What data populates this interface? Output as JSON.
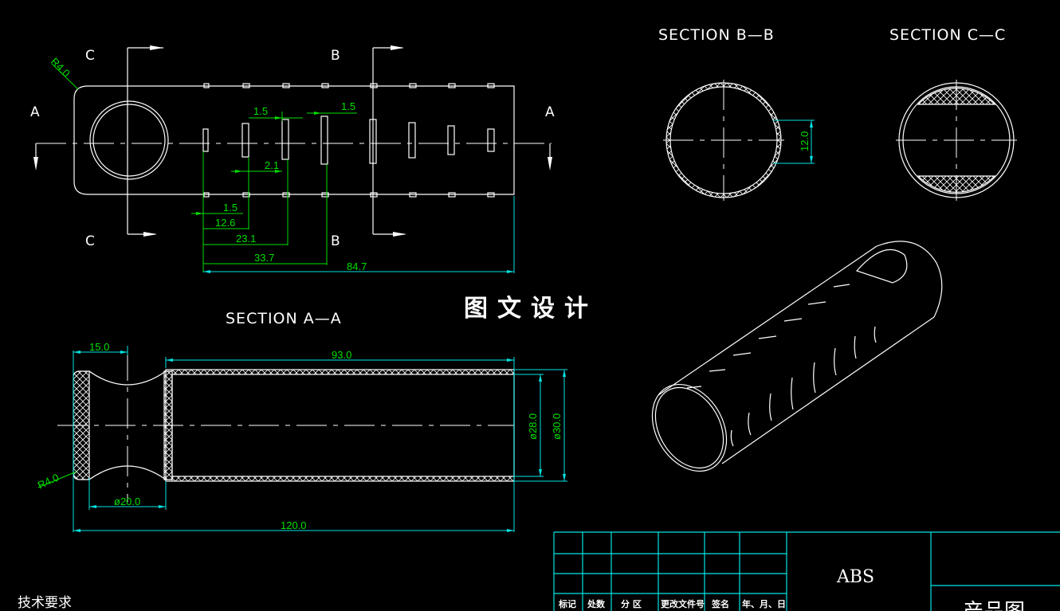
{
  "views": {
    "section_bb": "SECTION B—B",
    "section_cc": "SECTION C—C",
    "section_aa": "SECTION A—A",
    "cut_a_left": "A",
    "cut_a_right": "A",
    "cut_b_top": "B",
    "cut_b_bottom": "B",
    "cut_c_top": "C",
    "cut_c_bottom": "C"
  },
  "dimensions_top": {
    "radius": "R4.0",
    "slot_width_a": "1.5",
    "slot_width_b": "1.5",
    "slot_gap": "2.1",
    "offset_1": "1.5",
    "offset_2": "12.6",
    "offset_3": "23.1",
    "offset_4": "33.7",
    "offset_5": "84.7"
  },
  "dimensions_bb": {
    "height": "12.0"
  },
  "dimensions_aa": {
    "end_length": "15.0",
    "tube_length": "93.0",
    "inner_dia": "ø28.0",
    "outer_dia": "ø30.0",
    "radius": "R4.0",
    "neck_dia": "ø20.0",
    "total_length": "120.0"
  },
  "watermark": "图文设计",
  "title_block": {
    "material": "ABS",
    "headers": [
      "标记",
      "处数",
      "分 区",
      "更改文件号",
      "签名",
      "年、月、日"
    ],
    "drawing_title": "产品图"
  },
  "notes_title": "技术要求",
  "colors": {
    "background": "#000000",
    "geometry": "#ffffff",
    "dimension": "#00e000",
    "dimension_alt": "#00e5e5"
  }
}
